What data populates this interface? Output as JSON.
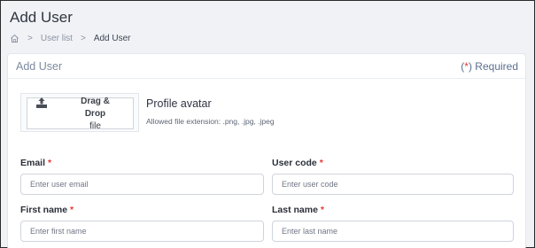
{
  "page": {
    "title": "Add User"
  },
  "breadcrumb": {
    "home_icon": "home-icon",
    "separator": ">",
    "items": [
      "User list",
      "Add User"
    ]
  },
  "card": {
    "title": "Add User",
    "required_note": {
      "open": "(",
      "star": "*",
      "close": ")",
      "text": " Required"
    }
  },
  "avatar": {
    "upload_icon": "upload-icon",
    "drag_drop_text": "Drag & Drop",
    "file_text": "file",
    "label": "Profile avatar",
    "hint": "Allowed file extension: .png, .jpg, .jpeg"
  },
  "form": {
    "email": {
      "label": "Email",
      "required_mark": "*",
      "value": "",
      "placeholder": "Enter user email"
    },
    "user_code": {
      "label": "User code",
      "required_mark": "*",
      "value": "",
      "placeholder": "Enter user code"
    },
    "first_name": {
      "label": "First name",
      "required_mark": "*",
      "value": "",
      "placeholder": "Enter first name"
    },
    "last_name": {
      "label": "Last name",
      "required_mark": "*",
      "value": "",
      "placeholder": "Enter last name"
    }
  },
  "colors": {
    "page_bg": "#f1f2f5",
    "card_bg": "#ffffff",
    "required_red": "#e53935",
    "accent_blue": "#5a6f8f"
  }
}
